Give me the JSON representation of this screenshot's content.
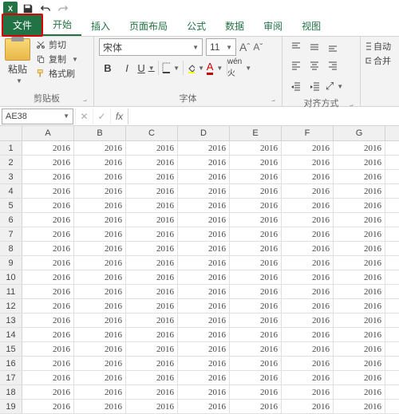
{
  "titlebar": {
    "app": "X"
  },
  "tabs": {
    "file": "文件",
    "items": [
      "开始",
      "插入",
      "页面布局",
      "公式",
      "数据",
      "审阅",
      "视图"
    ],
    "active": 0
  },
  "ribbon": {
    "clipboard": {
      "paste": "粘贴",
      "cut": "剪切",
      "copy": "复制",
      "format_painter": "格式刷",
      "label": "剪贴板"
    },
    "font": {
      "name": "宋体",
      "size": "11",
      "label": "字体"
    },
    "align": {
      "label": "对齐方式",
      "auto_wrap": "自动",
      "merge": "合并"
    }
  },
  "formula": {
    "name_box": "AE38"
  },
  "grid": {
    "cols": [
      "A",
      "B",
      "C",
      "D",
      "E",
      "F",
      "G"
    ],
    "rows": 19,
    "value": "2016"
  }
}
